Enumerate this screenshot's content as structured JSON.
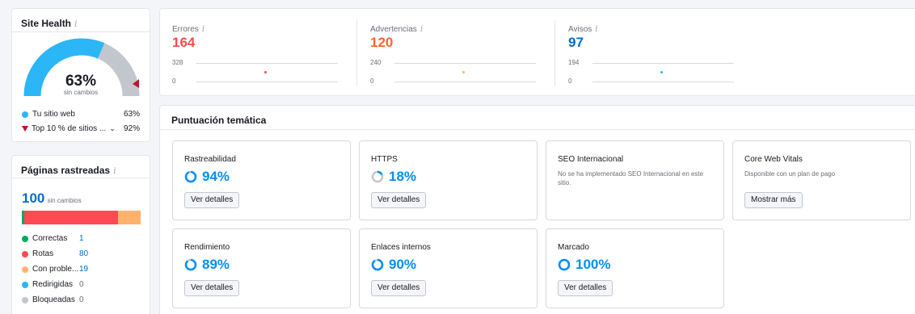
{
  "site_health": {
    "title": "Site Health",
    "info_icon": "i",
    "percent": "63%",
    "status": "sin cambios",
    "gauge_fraction": 0.63,
    "colors": {
      "fill": "#2bb6f7",
      "rest": "#c2c7cd",
      "marker": "#c4102b"
    },
    "legend": [
      {
        "label": "Tu sitio web",
        "value": "63%",
        "color": "#2bb6f7"
      },
      {
        "label": "Top 10 % de sitios ...",
        "value": "92%",
        "color": "#c4102b"
      }
    ]
  },
  "crawled": {
    "title": "Páginas rastreadas",
    "info_icon": "i",
    "total": "100",
    "status": "sin cambios",
    "rows": [
      {
        "label": "Correctas",
        "value": "1",
        "color": "#00a95f"
      },
      {
        "label": "Rotas",
        "value": "80",
        "color": "#ff4953"
      },
      {
        "label": "Con proble...",
        "value": "19",
        "color": "#ffb26c"
      },
      {
        "label": "Redirigidas",
        "value": "0",
        "color": "#2bb6f7"
      },
      {
        "label": "Bloqueadas",
        "value": "0",
        "color": "#c2c7cd"
      }
    ]
  },
  "metrics": [
    {
      "label": "Errores",
      "value": "164",
      "color": "#ff4953",
      "max_tick": "328",
      "min_tick": "0"
    },
    {
      "label": "Advertencias",
      "value": "120",
      "color": "#ff642d",
      "max_tick": "240",
      "min_tick": "0"
    },
    {
      "label": "Avisos",
      "value": "97",
      "color": "#006dca",
      "max_tick": "194",
      "min_tick": "0"
    }
  ],
  "thematic": {
    "title": "Puntuación temática",
    "cards": [
      {
        "name": "Rastreabilidad",
        "score": "94%",
        "fraction": 0.94,
        "button": "Ver detalles"
      },
      {
        "name": "HTTPS",
        "score": "18%",
        "fraction": 0.18,
        "button": "Ver detalles"
      },
      {
        "name": "SEO Internacional",
        "desc": "No se ha implementado SEO Internacional en este sitio."
      },
      {
        "name": "Core Web Vitals",
        "desc": "Disponible con un plan de pago",
        "button": "Mostrar más"
      },
      {
        "name": "Rendimiento",
        "score": "89%",
        "fraction": 0.89,
        "button": "Ver detalles"
      },
      {
        "name": "Enlaces internos",
        "score": "90%",
        "fraction": 0.9,
        "button": "Ver detalles"
      },
      {
        "name": "Marcado",
        "score": "100%",
        "fraction": 1.0,
        "button": "Ver detalles"
      }
    ]
  }
}
